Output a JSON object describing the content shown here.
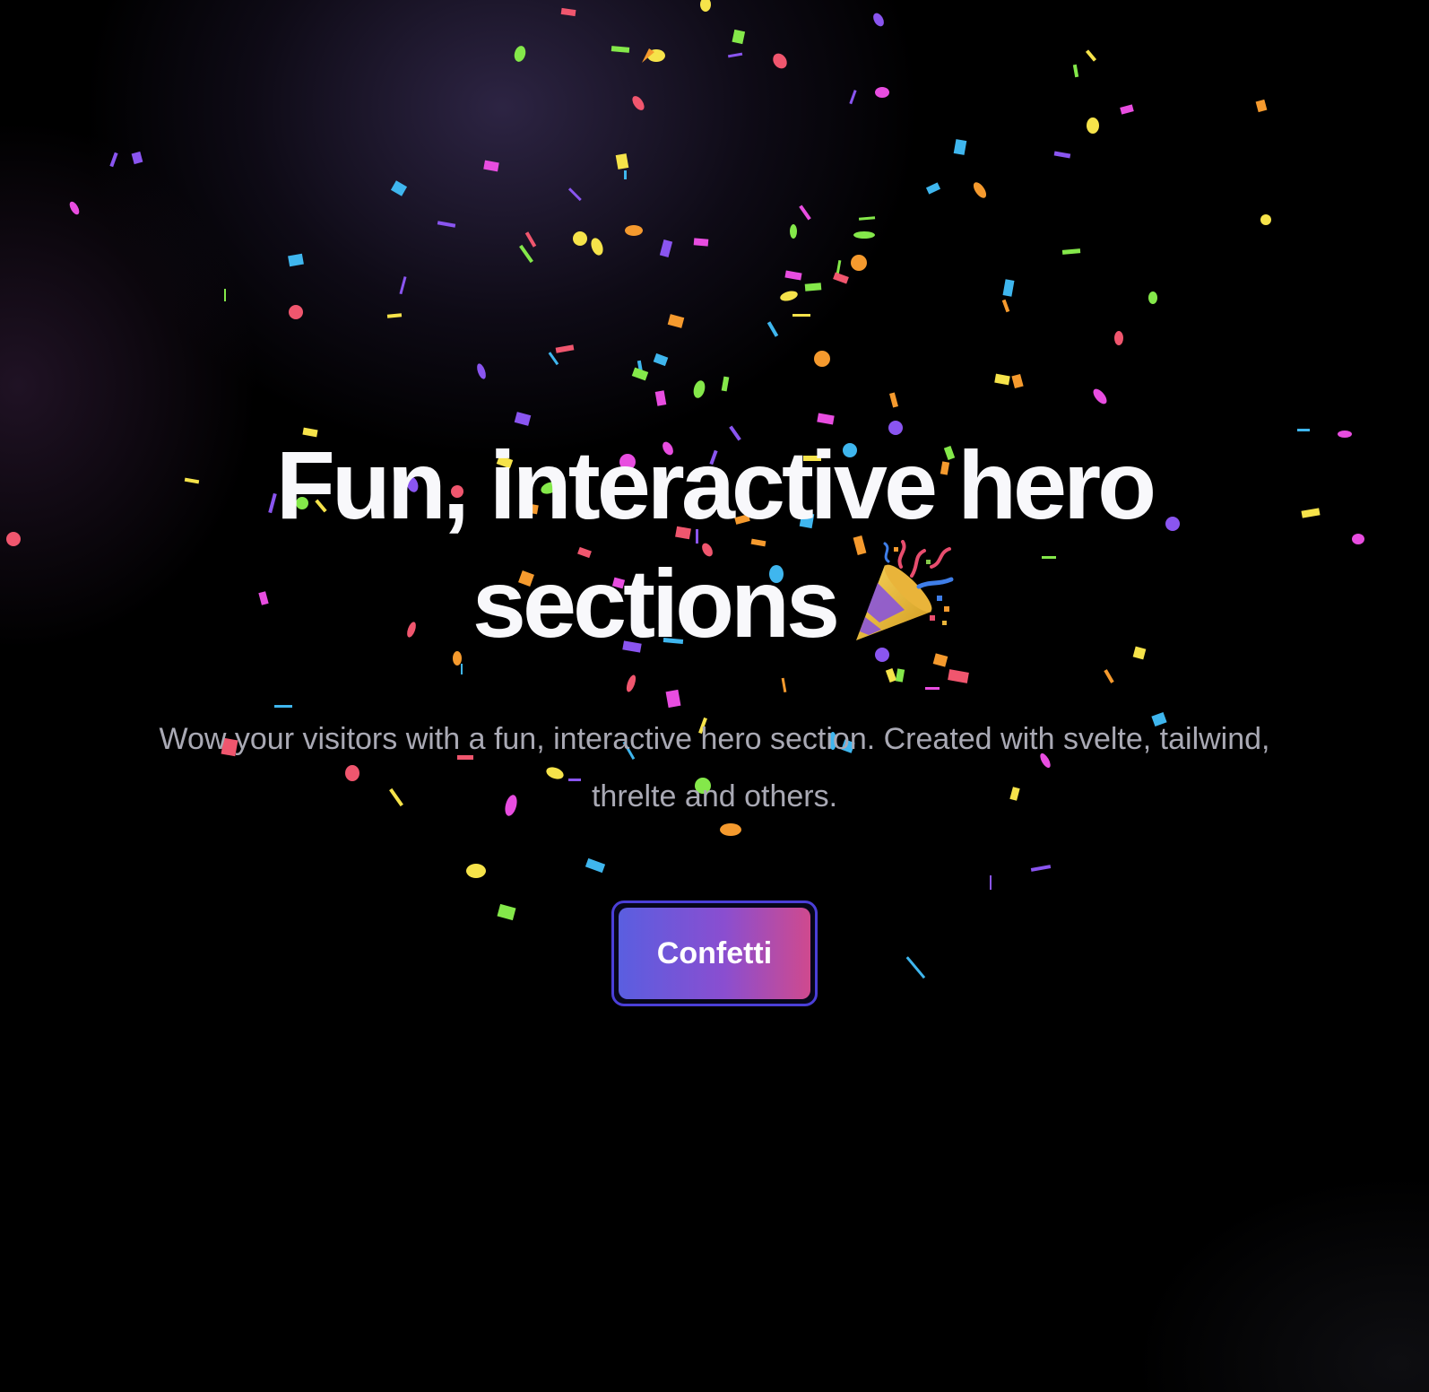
{
  "hero": {
    "title_line1": "Fun, interactive hero",
    "title_line2": "sections",
    "title_icon": "party-popper-icon",
    "subtitle": "Wow your visitors with a fun, interactive hero section. Created with svelte, tailwind, threlte and others.",
    "button_label": "Confetti"
  },
  "colors": {
    "background": "#000000",
    "title": "#f8f8fb",
    "subtitle": "#a9a9b4",
    "button_border": "#4b3fd8",
    "button_gradient_start": "#5a5ee0",
    "button_gradient_end": "#cf4a8e",
    "confetti": [
      "#f6e34a",
      "#e84de0",
      "#3fb6ee",
      "#84e84a",
      "#f59a2e",
      "#f0566e",
      "#8a55f0"
    ]
  }
}
